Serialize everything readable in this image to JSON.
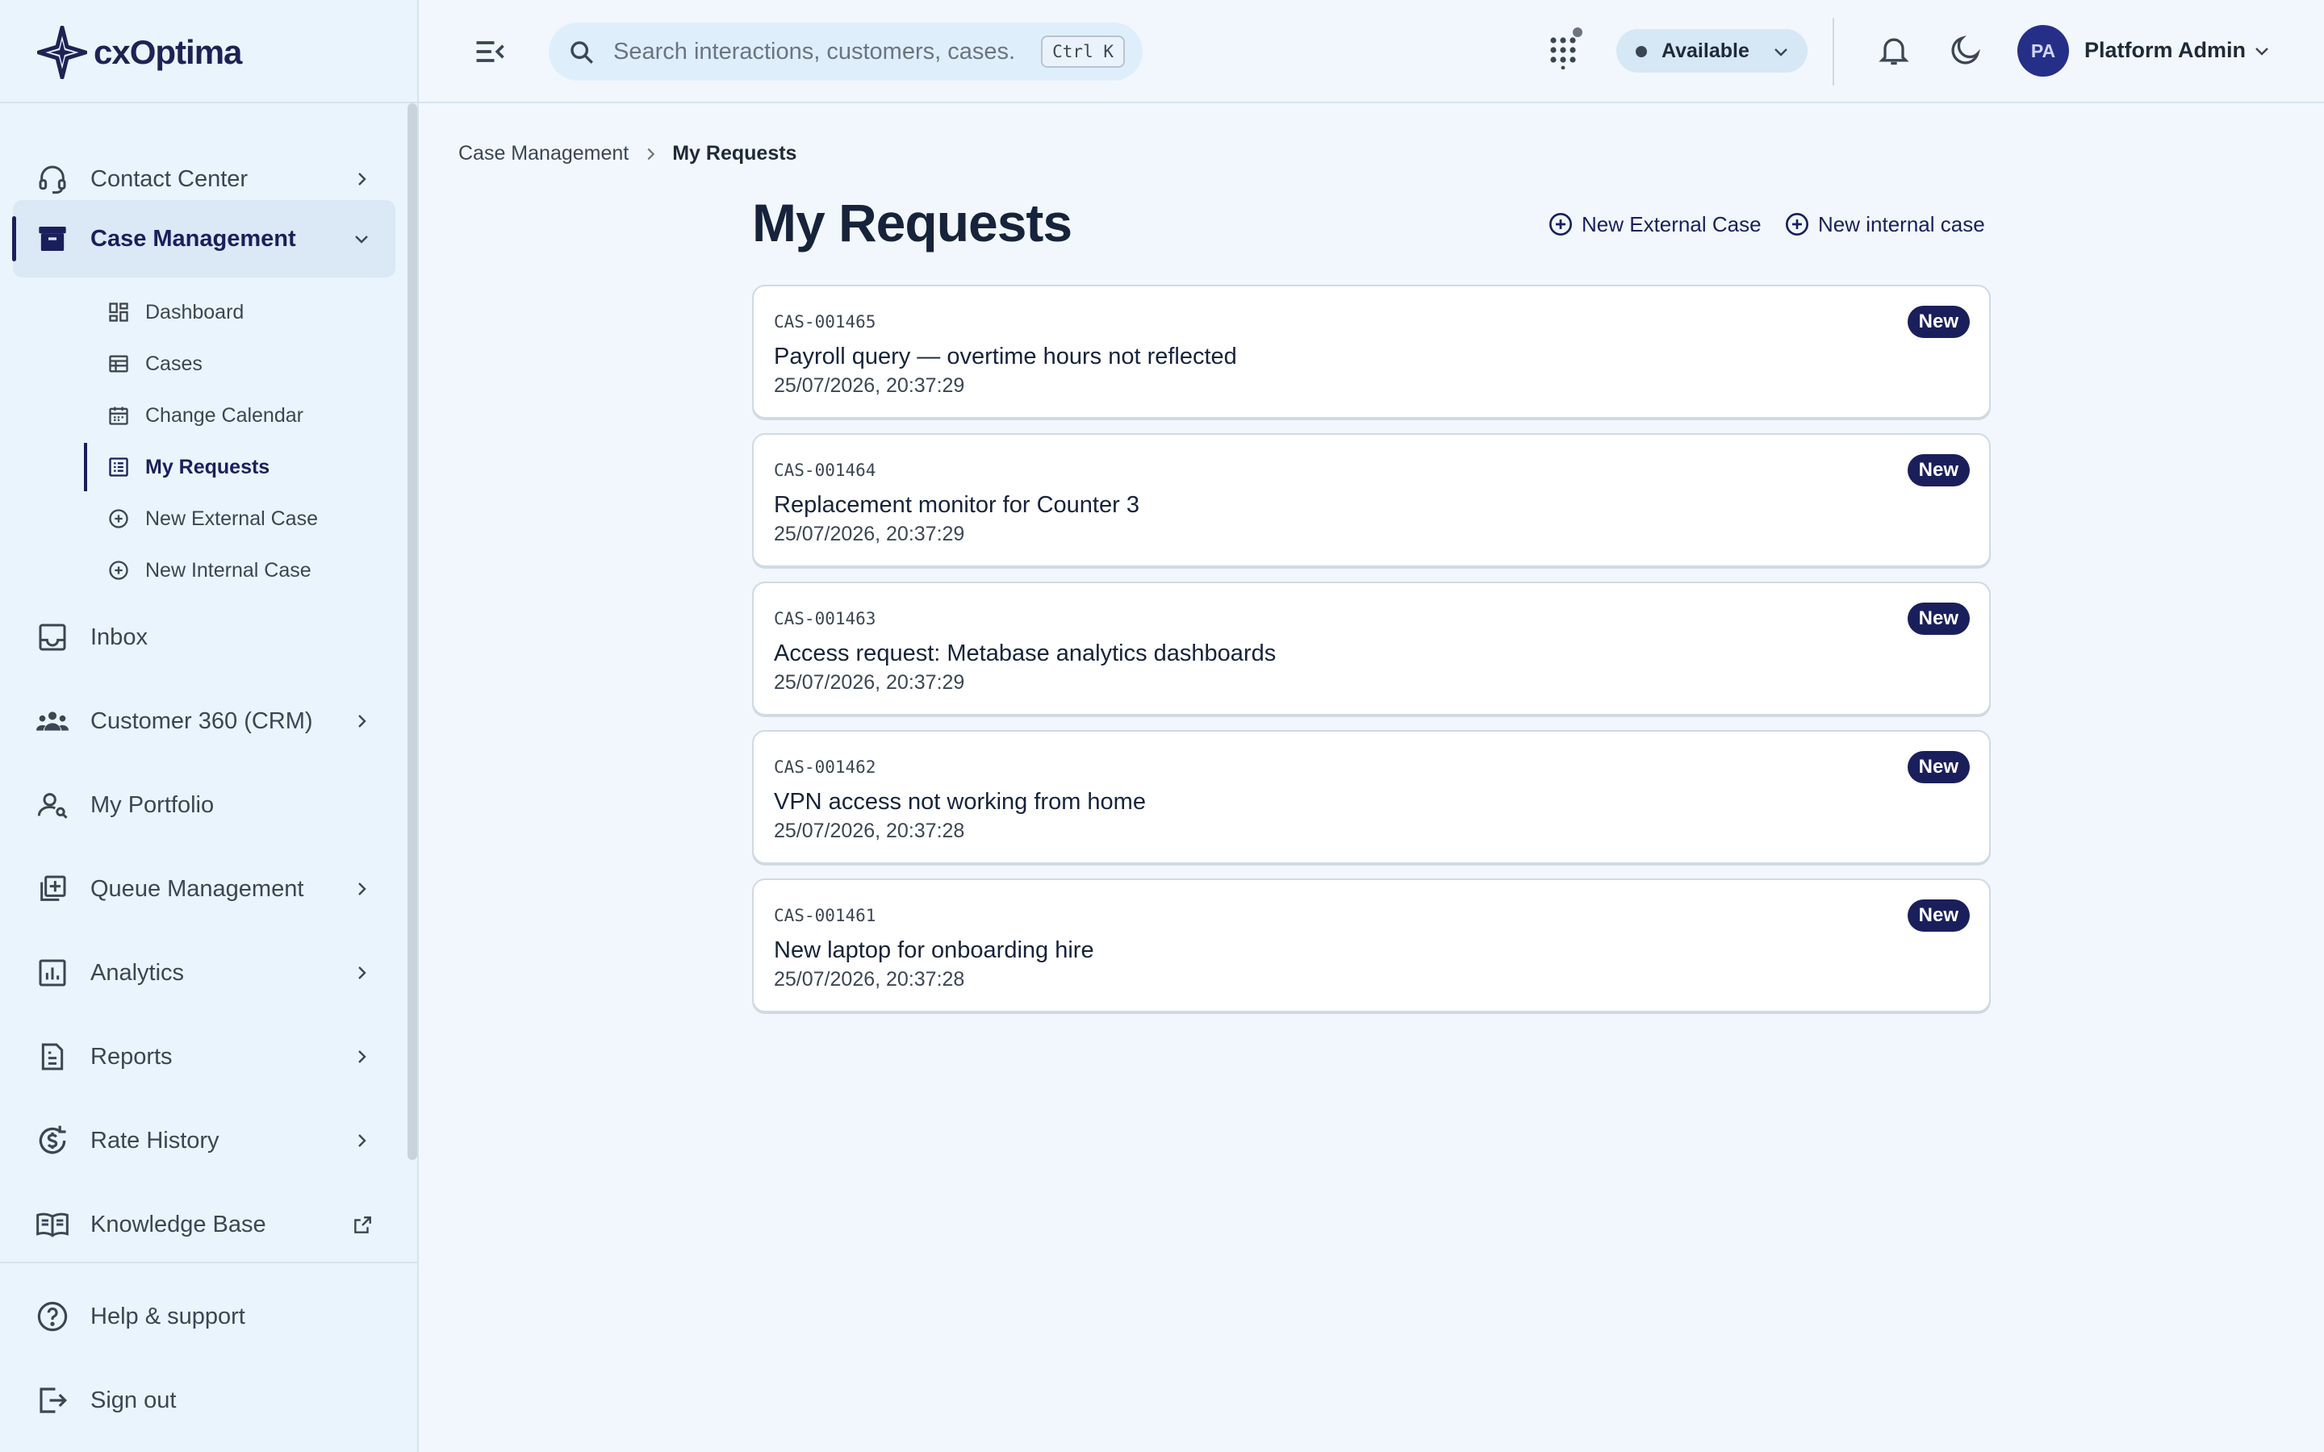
{
  "app": {
    "brand": "cxOptima"
  },
  "header": {
    "search_placeholder": "Search interactions, customers, cases...",
    "search_shortcut": "Ctrl K",
    "status_label": "Available",
    "user_initials": "PA",
    "user_name": "Platform Admin"
  },
  "sidebar": {
    "items": [
      {
        "label": "Contact Center",
        "icon": "headset-icon"
      },
      {
        "label": "Case Management",
        "icon": "archive-icon",
        "active": true,
        "expanded": true
      },
      {
        "label": "Inbox",
        "icon": "inbox-icon"
      },
      {
        "label": "Customer 360 (CRM)",
        "icon": "people-icon"
      },
      {
        "label": "My Portfolio",
        "icon": "person-icon"
      },
      {
        "label": "Queue Management",
        "icon": "queue-icon"
      },
      {
        "label": "Analytics",
        "icon": "analytics-icon"
      },
      {
        "label": "Reports",
        "icon": "report-icon"
      },
      {
        "label": "Rate History",
        "icon": "currency-history-icon"
      },
      {
        "label": "Knowledge Base",
        "icon": "book-icon"
      }
    ],
    "sub_items": [
      {
        "label": "Dashboard",
        "icon": "dashboard-icon"
      },
      {
        "label": "Cases",
        "icon": "table-icon"
      },
      {
        "label": "Change Calendar",
        "icon": "calendar-icon"
      },
      {
        "label": "My Requests",
        "icon": "list-icon",
        "active": true
      },
      {
        "label": "New External Case",
        "icon": "plus-circle-icon"
      },
      {
        "label": "New Internal Case",
        "icon": "plus-circle-icon"
      }
    ],
    "footer": [
      {
        "label": "Help & support",
        "icon": "help-icon"
      },
      {
        "label": "Sign out",
        "icon": "logout-icon"
      }
    ]
  },
  "breadcrumb": {
    "parent": "Case Management",
    "current": "My Requests"
  },
  "page": {
    "title": "My Requests",
    "new_external_label": "New External Case",
    "new_internal_label": "New internal case"
  },
  "requests": [
    {
      "id": "CAS-001465",
      "title": "Payroll query — overtime hours not reflected",
      "date": "25/07/2026, 20:37:29",
      "status": "New"
    },
    {
      "id": "CAS-001464",
      "title": "Replacement monitor for Counter 3",
      "date": "25/07/2026, 20:37:29",
      "status": "New"
    },
    {
      "id": "CAS-001463",
      "title": "Access request: Metabase analytics dashboards",
      "date": "25/07/2026, 20:37:29",
      "status": "New"
    },
    {
      "id": "CAS-001462",
      "title": "VPN access not working from home",
      "date": "25/07/2026, 20:37:28",
      "status": "New"
    },
    {
      "id": "CAS-001461",
      "title": "New laptop for onboarding hire",
      "date": "25/07/2026, 20:37:28",
      "status": "New"
    }
  ],
  "colors": {
    "accent": "#1a1f5c",
    "badge_bg": "#1a1f5c",
    "background": "#f1f7fd",
    "sidebar_bg": "#eaf4fd"
  }
}
